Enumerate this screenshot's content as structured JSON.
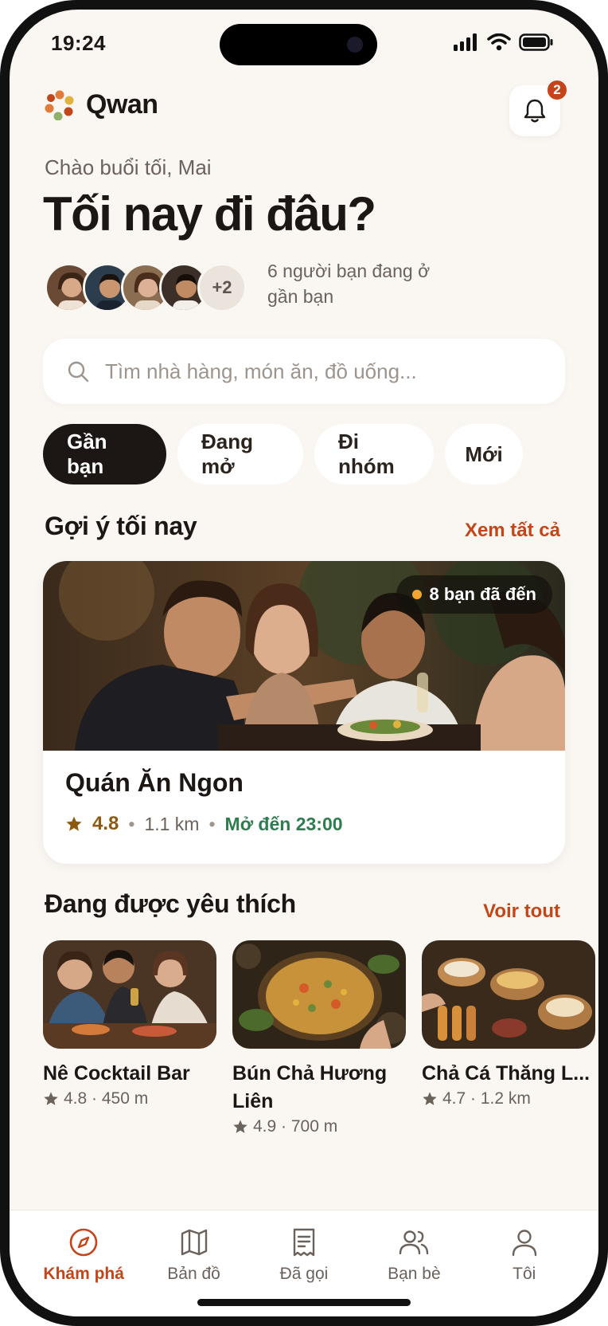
{
  "status_bar": {
    "time": "19:24"
  },
  "header": {
    "app_name": "Qwan",
    "notification_count": "2"
  },
  "greeting": "Chào buổi tối, Mai",
  "headline": "Tối nay đi đâu?",
  "friends": {
    "more_label": "+2",
    "text": "6 người bạn đang ở gần bạn"
  },
  "search": {
    "placeholder": "Tìm nhà hàng, món ăn, đồ uống..."
  },
  "chips": [
    "Gần bạn",
    "Đang mở",
    "Đi nhóm",
    "Mới"
  ],
  "tonight": {
    "title": "Gợi ý tối nay",
    "see_all": "Xem tất cả",
    "feature": {
      "friends_visited": "8 bạn đã đến",
      "name": "Quán Ăn Ngon",
      "rating": "4.8",
      "distance": "1.1 km",
      "hours": "Mở đến 23:00"
    }
  },
  "popular": {
    "title": "Đang được yêu thích",
    "see_all": "Voir tout",
    "items": [
      {
        "name": "Nê Cocktail Bar",
        "meta": "4.8 · 450 m"
      },
      {
        "name": "Bún Chả Hương Liên",
        "meta": "4.9 · 700 m"
      },
      {
        "name": "Chả Cá Thăng L...",
        "meta": "4.7 · 1.2 km"
      }
    ]
  },
  "tabbar": {
    "items": [
      {
        "label": "Khám phá",
        "icon": "compass-icon"
      },
      {
        "label": "Bản đồ",
        "icon": "map-icon"
      },
      {
        "label": "Đã gọi",
        "icon": "receipt-icon"
      },
      {
        "label": "Bạn bè",
        "icon": "users-icon"
      },
      {
        "label": "Tôi",
        "icon": "user-icon"
      }
    ]
  },
  "colors": {
    "accent": "#c2461a",
    "open_green": "#2e7d4f",
    "background": "#faf6f2",
    "dark": "#1c1714"
  }
}
